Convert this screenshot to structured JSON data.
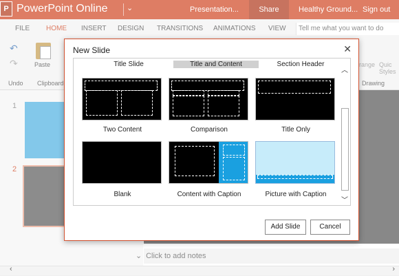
{
  "app": {
    "logo_letter": "P",
    "name": "PowerPoint Online",
    "dropdown_glyph": "⌄",
    "document": "Presentation...",
    "share": "Share",
    "user": "Healthy Ground...",
    "sign_out": "Sign out",
    "brand_color": "#d35230"
  },
  "tabs": [
    {
      "label": "FILE"
    },
    {
      "label": "HOME",
      "active": true
    },
    {
      "label": "INSERT"
    },
    {
      "label": "DESIGN"
    },
    {
      "label": "TRANSITIONS"
    },
    {
      "label": "ANIMATIONS"
    },
    {
      "label": "VIEW"
    }
  ],
  "tell_me": "Tell me what you want to do",
  "ribbon": {
    "undo_label": "Undo",
    "paste_label": "Paste",
    "clipboard_label": "Clipboard",
    "drawing_label": "Drawing",
    "arrange_partial": "range",
    "quick_styles_partial": "Quic Styles"
  },
  "slides": [
    {
      "number": "1"
    },
    {
      "number": "2"
    }
  ],
  "notes_placeholder": "Click to add notes",
  "dialog": {
    "title": "New Slide",
    "close_glyph": "✕",
    "layouts": [
      {
        "label": "Title Slide",
        "selected": false
      },
      {
        "label": "Title and Content",
        "selected": true
      },
      {
        "label": "Section Header",
        "selected": false
      },
      {
        "label": "Two Content",
        "selected": false
      },
      {
        "label": "Comparison",
        "selected": false
      },
      {
        "label": "Title Only",
        "selected": false
      },
      {
        "label": "Blank",
        "selected": false
      },
      {
        "label": "Content with Caption",
        "selected": false
      },
      {
        "label": "Picture with Caption",
        "selected": false
      }
    ],
    "add_button": "Add Slide",
    "cancel_button": "Cancel"
  }
}
